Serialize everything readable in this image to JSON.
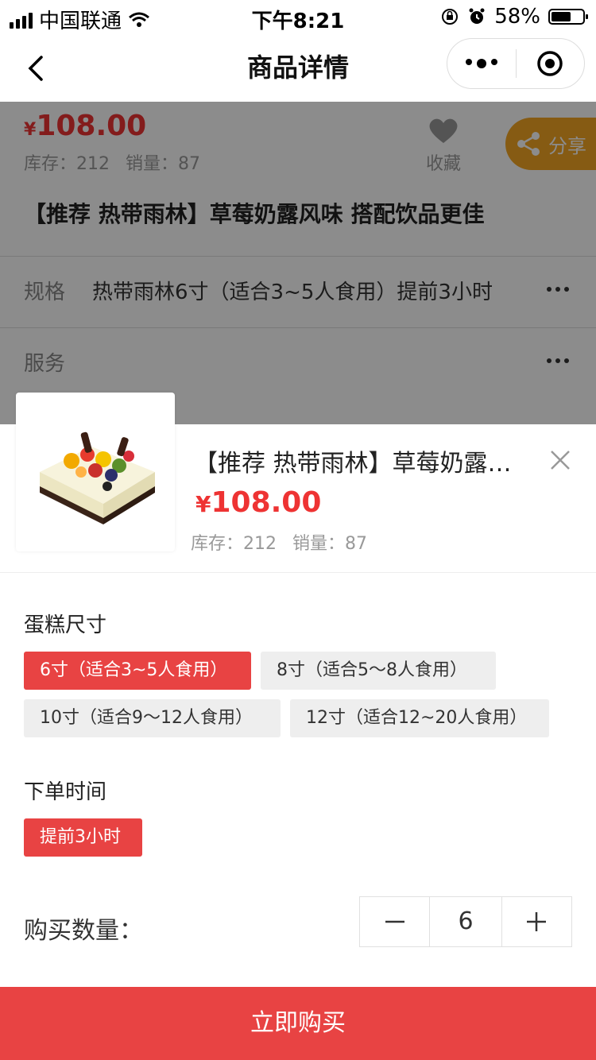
{
  "status_bar": {
    "carrier": "中国联通",
    "time": "下午8:21",
    "battery": "58%"
  },
  "nav": {
    "title": "商品详情"
  },
  "product": {
    "currency": "¥",
    "price": "108.00",
    "stock_label": "库存：212",
    "sales_label": "销量：87",
    "favorite_label": "收藏",
    "share_label": "分享",
    "title": "【推荐 热带雨林】草莓奶露风味 搭配饮品更佳",
    "spec_label": "规格",
    "spec_value": "热带雨林6寸（适合3~5人食用）提前3小时",
    "service_label": "服务"
  },
  "sheet": {
    "title": "【推荐 热带雨林】草莓奶露风味 搭配饮品更佳",
    "currency": "¥",
    "price": "108.00",
    "stock_label": "库存：212",
    "sales_label": "销量：87",
    "size_title": "蛋糕尺寸",
    "size_options": [
      {
        "label": "6寸（适合3~5人食用）",
        "selected": true
      },
      {
        "label": "8寸（适合5～8人食用）",
        "selected": false
      },
      {
        "label": "10寸（适合9～12人食用）",
        "selected": false
      },
      {
        "label": "12寸（适合12~20人食用）",
        "selected": false
      }
    ],
    "time_title": "下单时间",
    "time_options": [
      {
        "label": "提前3小时",
        "selected": true
      }
    ],
    "quantity_label": "购买数量：",
    "quantity": "6",
    "buy_label": "立即购买"
  },
  "colors": {
    "accent": "#e84343",
    "share": "#f5a623"
  }
}
